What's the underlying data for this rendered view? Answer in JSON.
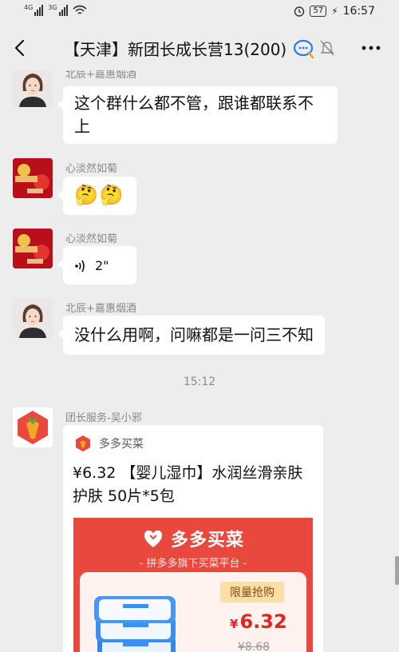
{
  "status_bar": {
    "network_1": "4G",
    "network_2": "3G",
    "battery": "57",
    "time": "16:57"
  },
  "nav": {
    "title": "【天津】新团长成长营13(200)",
    "icons": [
      "back-arrow-icon",
      "group-chat-icon",
      "mute-bell-icon",
      "more-icon"
    ]
  },
  "messages": [
    {
      "sender": "北辰+嘉惠烟酒",
      "text": "这个群什么都不管，跟谁都联系不上"
    },
    {
      "sender": "心淡然如菊",
      "text": "🤔🤔"
    },
    {
      "sender": "心淡然如菊",
      "voice_duration": "2\""
    },
    {
      "sender": "北辰+嘉惠烟酒",
      "text": "没什么用啊，问嘛都是一问三不知"
    }
  ],
  "timestamp": "15:12",
  "card": {
    "sender": "团长服务-吴小邪",
    "app_name": "多多买菜",
    "title": "¥6.32 【婴儿湿巾】水润丝滑亲肤护肤 50片*5包",
    "promo_brand": "多多买菜",
    "promo_tagline": "- 拼多多旗下买菜平台 -",
    "tag": "限量抢购",
    "price_symbol": "¥",
    "price": "6.32",
    "old_price": "¥8.68"
  },
  "colors": {
    "background": "#ededed",
    "bubble": "#ffffff",
    "brand_red": "#e8483d",
    "price_red": "#e2251e"
  }
}
